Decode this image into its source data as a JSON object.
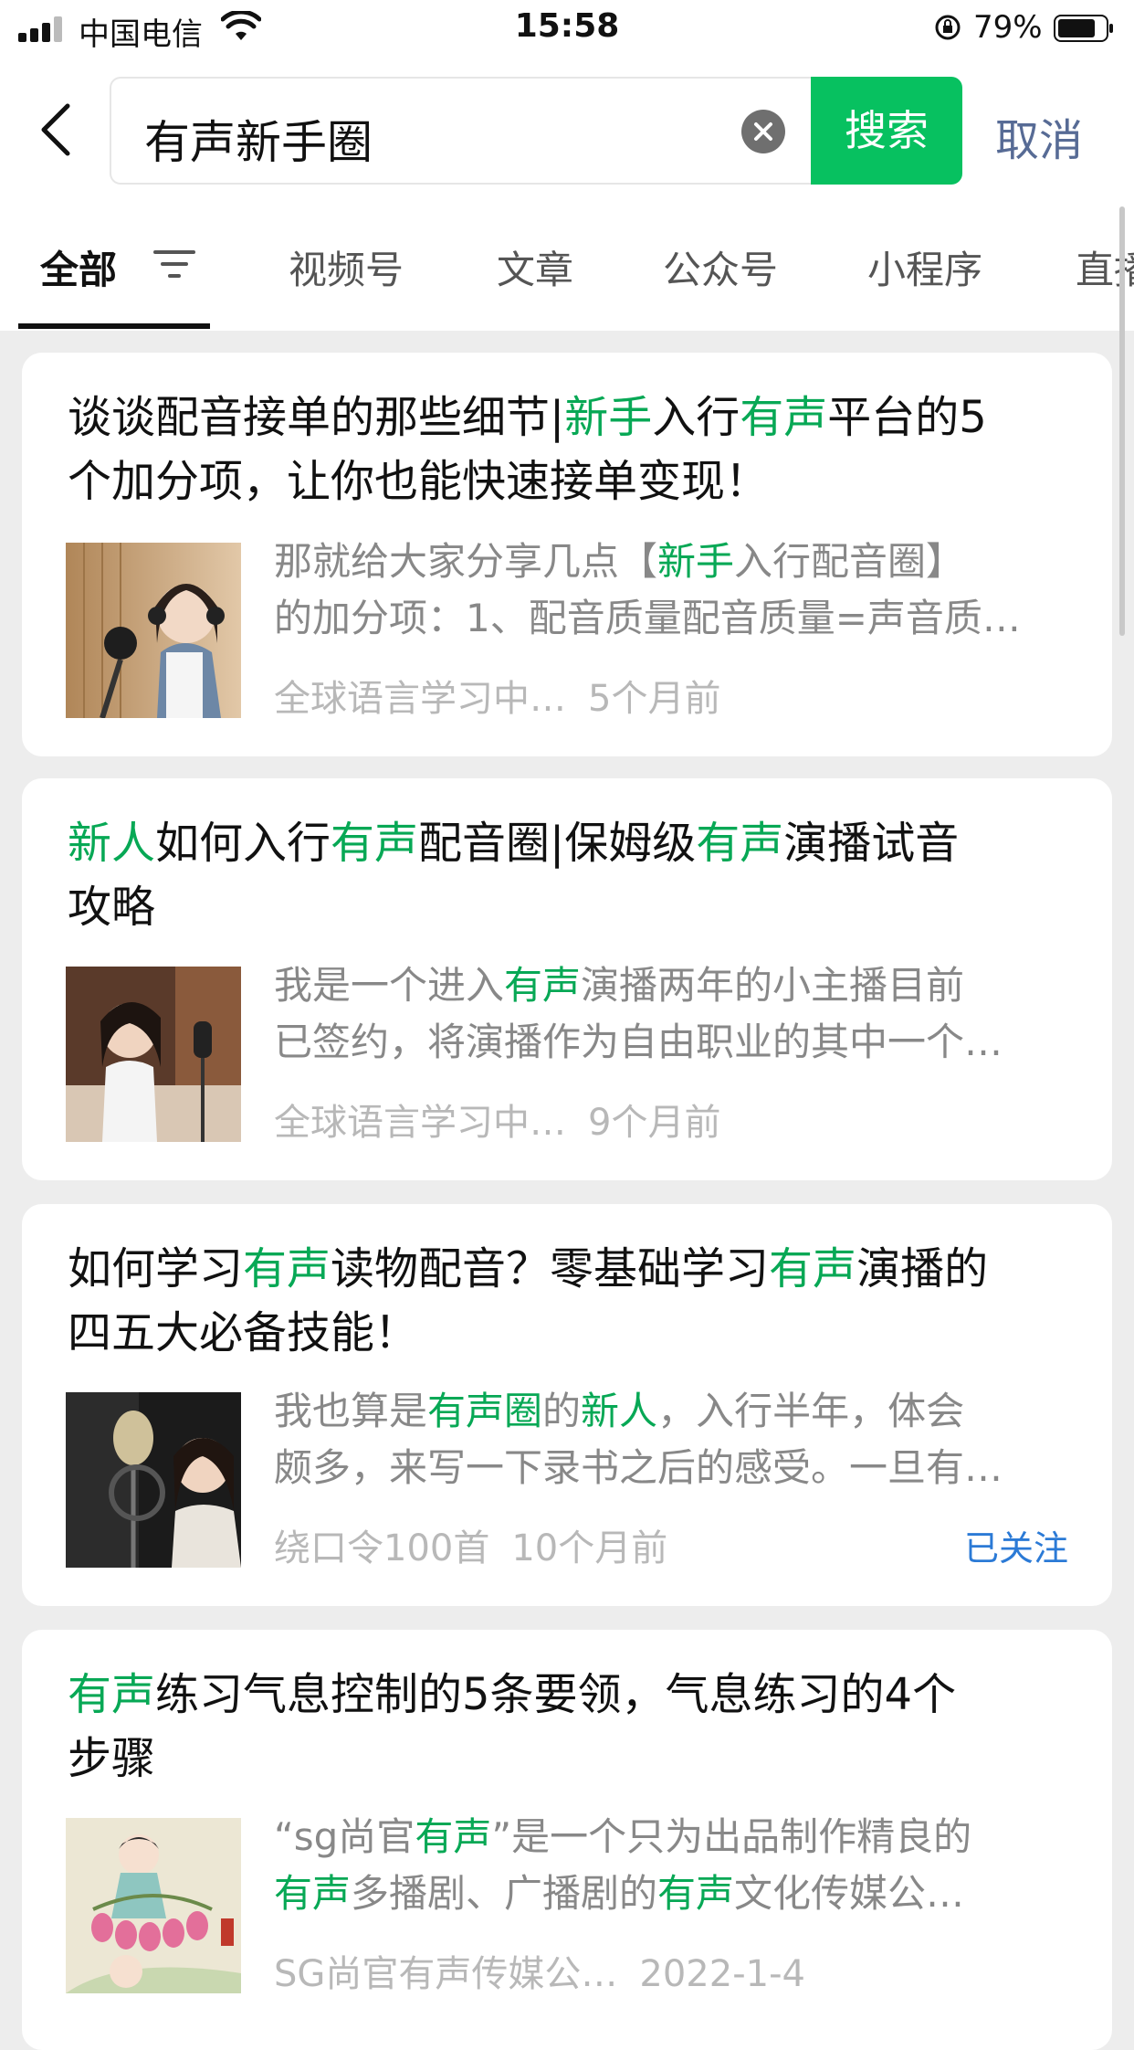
{
  "status_bar": {
    "carrier": "中国电信",
    "time": "15:58",
    "battery": "79%"
  },
  "search": {
    "query": "有声新手圈",
    "button": "搜索",
    "cancel": "取消"
  },
  "tabs": [
    {
      "label": "全部",
      "active": true
    },
    {
      "label": "视频号"
    },
    {
      "label": "文章"
    },
    {
      "label": "公众号"
    },
    {
      "label": "小程序"
    },
    {
      "label": "直播"
    }
  ],
  "results": [
    {
      "title_parts": [
        {
          "t": "谈谈配音接单的那些细节|"
        },
        {
          "t": "新手",
          "hl": true
        },
        {
          "t": "入行"
        },
        {
          "t": "有声",
          "hl": true
        },
        {
          "t": "平台的5"
        },
        {
          "br": true
        },
        {
          "t": "个加分项，让你也能快速接单变现！"
        }
      ],
      "desc_line1": [
        {
          "t": "那就给大家分享几点【"
        },
        {
          "t": "新手",
          "hl": true
        },
        {
          "t": "入行配音圈】"
        }
      ],
      "desc_line2": [
        {
          "t": "的加分项：1、配音质量配音质量=声音质…"
        }
      ],
      "source": "全球语言学习中…",
      "time": "5个月前"
    },
    {
      "title_parts": [
        {
          "t": "新人",
          "hl": true
        },
        {
          "t": "如何入行"
        },
        {
          "t": "有声",
          "hl": true
        },
        {
          "t": "配音圈|保姆级"
        },
        {
          "t": "有声",
          "hl": true
        },
        {
          "t": "演播试音"
        },
        {
          "br": true
        },
        {
          "t": "攻略"
        }
      ],
      "desc_line1": [
        {
          "t": "我是一个进入"
        },
        {
          "t": "有声",
          "hl": true
        },
        {
          "t": "演播两年的小主播目前"
        }
      ],
      "desc_line2": [
        {
          "t": "已签约，将演播作为自由职业的其中一个…"
        }
      ],
      "source": "全球语言学习中…",
      "time": "9个月前"
    },
    {
      "title_parts": [
        {
          "t": "如何学习"
        },
        {
          "t": "有声",
          "hl": true
        },
        {
          "t": "读物配音？零基础学习"
        },
        {
          "t": "有声",
          "hl": true
        },
        {
          "t": "演播的"
        },
        {
          "br": true
        },
        {
          "t": "四五大必备技能！"
        }
      ],
      "desc_line1": [
        {
          "t": "我也算是"
        },
        {
          "t": "有声圈",
          "hl": true
        },
        {
          "t": "的"
        },
        {
          "t": "新人",
          "hl": true
        },
        {
          "t": "，入行半年，体会"
        }
      ],
      "desc_line2": [
        {
          "t": "颇多，来写一下录书之后的感受。一旦有…"
        }
      ],
      "source": "绕口令100首",
      "time": "10个月前",
      "follow": "已关注"
    },
    {
      "title_parts": [
        {
          "t": "有声",
          "hl": true
        },
        {
          "t": "练习气息控制的5条要领，气息练习的4个"
        },
        {
          "br": true
        },
        {
          "t": "步骤"
        }
      ],
      "desc_line1": [
        {
          "t": "“sg尚官"
        },
        {
          "t": "有声",
          "hl": true
        },
        {
          "t": "”是一个只为出品制作精良的"
        }
      ],
      "desc_line2": [
        {
          "t": "有声",
          "hl": true
        },
        {
          "t": "多播剧、广播剧的"
        },
        {
          "t": "有声",
          "hl": true
        },
        {
          "t": "文化传媒公…"
        }
      ],
      "source": "SG尚官有声传媒公…",
      "time": "2022-1-4"
    }
  ]
}
